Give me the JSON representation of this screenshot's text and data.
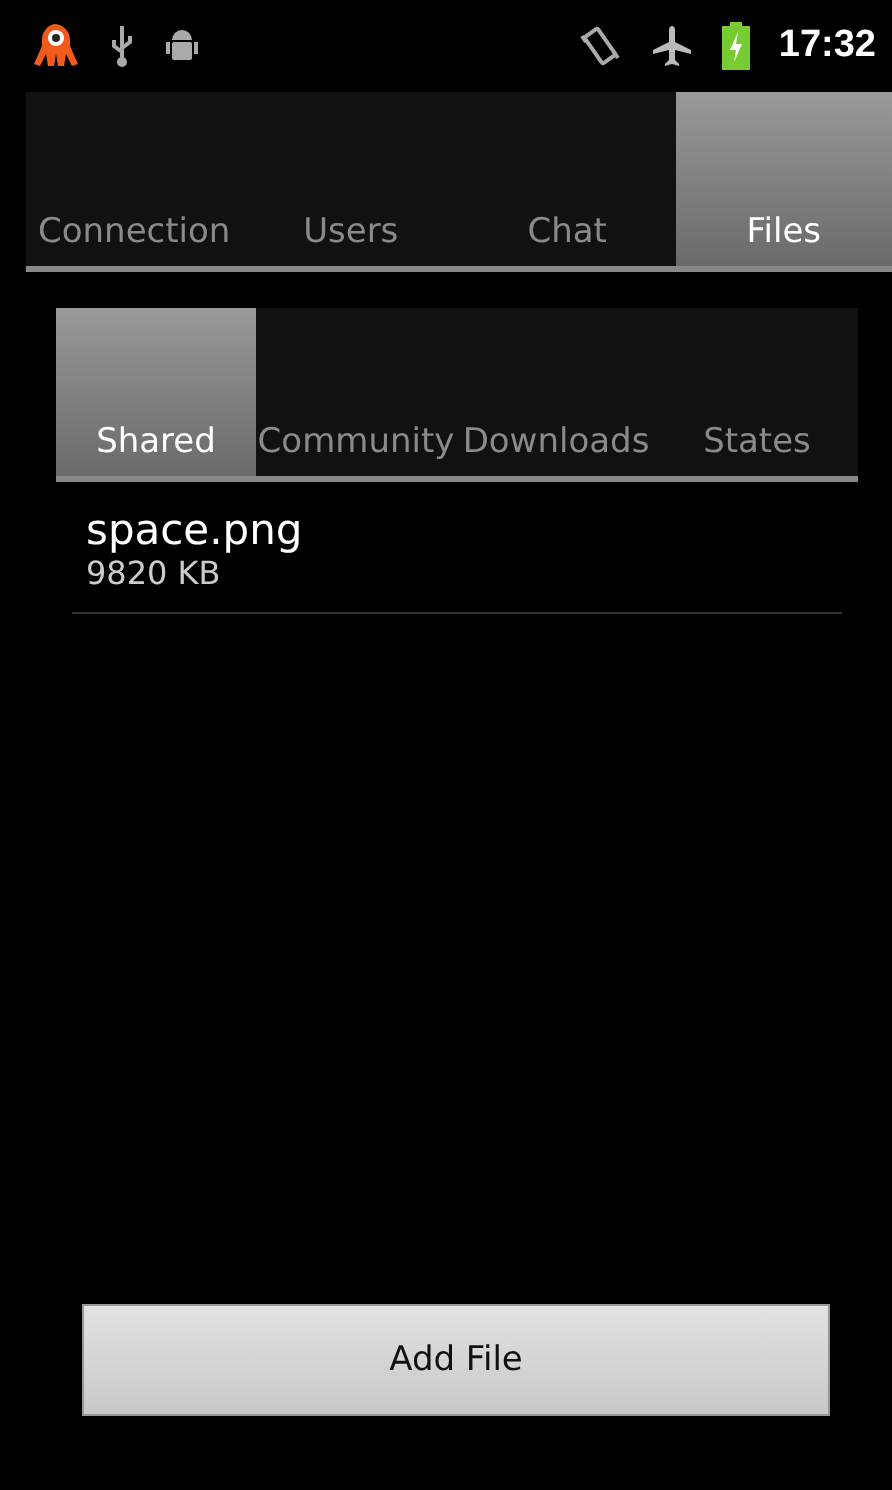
{
  "status_bar": {
    "time": "17:32"
  },
  "tabs": [
    {
      "label": "Connection",
      "selected": false
    },
    {
      "label": "Users",
      "selected": false
    },
    {
      "label": "Chat",
      "selected": false
    },
    {
      "label": "Files",
      "selected": true
    }
  ],
  "sub_tabs": [
    {
      "label": "Shared",
      "selected": true
    },
    {
      "label": "Community",
      "selected": false
    },
    {
      "label": "Downloads",
      "selected": false
    },
    {
      "label": "States",
      "selected": false
    }
  ],
  "files": [
    {
      "name": "space.png",
      "size": "9820 KB"
    }
  ],
  "add_button": "Add File"
}
